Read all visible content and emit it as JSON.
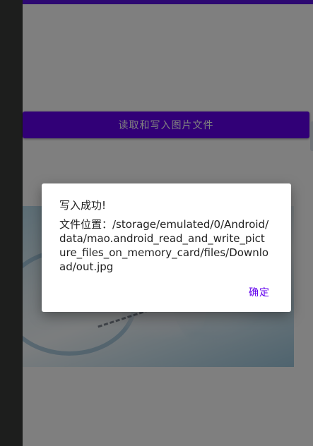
{
  "app": {
    "button_label": "读取和写入图片文件"
  },
  "dialog": {
    "title": "写入成功!",
    "message": "文件位置：/storage/emulated/0/Android/data/mao.android_read_and_write_picture_files_on_memory_card/files/Download/out.jpg",
    "ok_label": "确定"
  },
  "colors": {
    "accent": "#6200ee",
    "scrim": "rgba(0,0,0,0.5)"
  }
}
